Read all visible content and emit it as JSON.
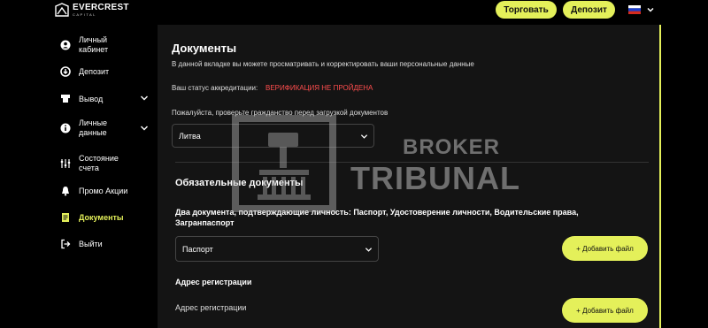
{
  "header": {
    "logo": {
      "name": "EVERCREST",
      "sub": "CAPITAL"
    },
    "trade_label": "Торговать",
    "deposit_label": "Депозит",
    "language_icon": "russia-flag-icon"
  },
  "sidebar": {
    "items": [
      {
        "label": "Личный\nкабинет",
        "icon": "user-icon",
        "has_submenu": false
      },
      {
        "label": "Депозит",
        "icon": "deposit-icon",
        "has_submenu": false
      },
      {
        "label": "Вывод",
        "icon": "withdraw-icon",
        "has_submenu": true
      },
      {
        "label": "Личные\nданные",
        "icon": "info-icon",
        "has_submenu": true
      },
      {
        "label": "Состояние\nсчета",
        "icon": "sliders-icon",
        "has_submenu": false
      },
      {
        "label": "Промо Акции",
        "icon": "bell-icon",
        "has_submenu": false
      },
      {
        "label": "Документы",
        "icon": "document-icon",
        "has_submenu": false,
        "active": true
      },
      {
        "label": "Выйти",
        "icon": "logout-icon",
        "has_submenu": false
      }
    ]
  },
  "main": {
    "title": "Документы",
    "subtitle": "В данной вкладке вы можете просматривать и корректировать ваши персональные данные",
    "status_label": "Ваш статус аккредитации:",
    "status_value": "ВЕРИФИКАЦИЯ НЕ ПРОЙДЕНА",
    "citizenship_note": "Пожалуйста, проверьте гражданство перед загрузкой документов",
    "country_selected": "Литва",
    "required_title": "Обязательные документы",
    "identity_desc": "Два документа, подтверждающие личность: Паспорт, Удостоверение личности, Водительские права, Загранпаспорт",
    "doc_type_selected": "Паспорт",
    "add_file_label": "+ Добавить файл",
    "address_title": "Адрес регистрации",
    "address_label": "Адрес регистрации"
  },
  "watermark": {
    "line1": "BROKER",
    "line2": "TRIBUNAL"
  },
  "colors": {
    "accent": "#e4f05a",
    "error": "#ff4d4d",
    "panel": "#141414",
    "background": "#000000"
  }
}
